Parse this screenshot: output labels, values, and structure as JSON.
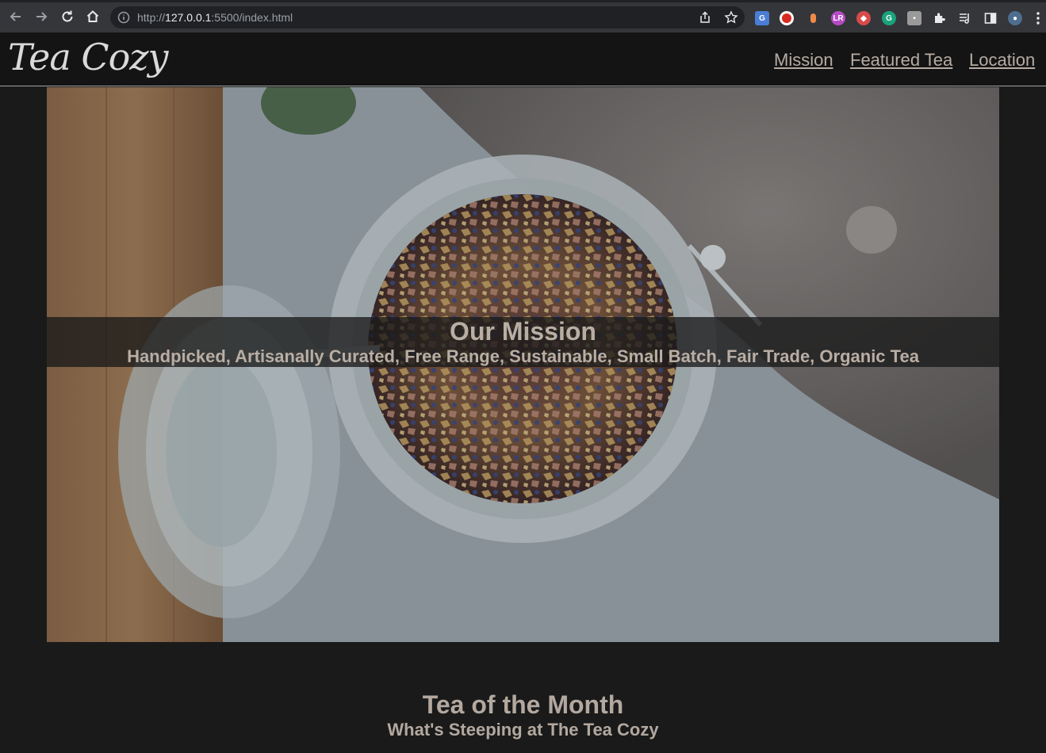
{
  "browser": {
    "url_scheme": "http://",
    "url_host": "127.0.0.1",
    "url_rest": ":5500/index.html"
  },
  "header": {
    "logo": "Tea Cozy",
    "nav": [
      {
        "label": "Mission"
      },
      {
        "label": "Featured Tea"
      },
      {
        "label": "Location"
      }
    ]
  },
  "hero": {
    "title": "Our Mission",
    "subtitle": "Handpicked, Artisanally Curated, Free Range, Sustainable, Small Batch, Fair Trade, Organic Tea"
  },
  "tea_of_month": {
    "title": "Tea of the Month",
    "subtitle": "What's Steeping at The Tea Cozy"
  },
  "colors": {
    "page_bg": "#1a1a1a",
    "header_bg": "#141414",
    "text_accent": "#b6aba2"
  },
  "icons": [
    "back-arrow-icon",
    "forward-arrow-icon",
    "reload-icon",
    "home-icon",
    "info-icon",
    "share-icon",
    "star-icon",
    "extensions-puzzle-icon",
    "reading-list-icon",
    "side-panel-icon",
    "menu-dots-icon"
  ]
}
